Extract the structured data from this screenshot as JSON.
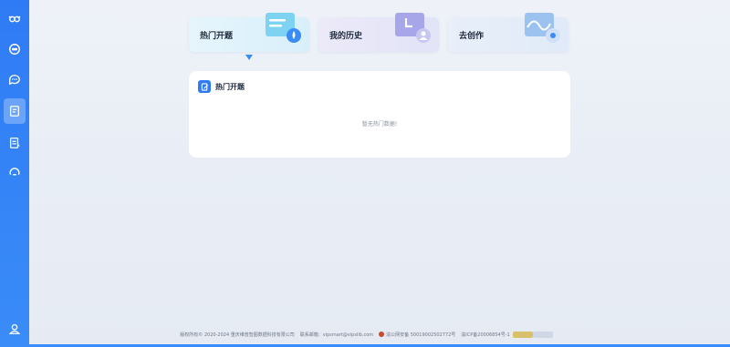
{
  "sidebar": {
    "items": [
      {
        "icon": "owl-logo-icon"
      },
      {
        "icon": "ai-ring-icon"
      },
      {
        "icon": "chat-bubble-icon"
      },
      {
        "icon": "document-icon",
        "active": true
      },
      {
        "icon": "notebook-icon"
      },
      {
        "icon": "cycle-icon"
      }
    ],
    "bottom_icon": "user-icon"
  },
  "tabs": [
    {
      "label": "热门开题",
      "icon": "hot-topic-illustration-icon"
    },
    {
      "label": "我的历史",
      "icon": "history-illustration-icon"
    },
    {
      "label": "去创作",
      "icon": "create-illustration-icon"
    }
  ],
  "panel": {
    "title": "热门开题",
    "empty_text": "暂无热门数据!"
  },
  "footer": {
    "copyright": "版权所有© 2020-2024 重庆维普智图数据科技有限公司",
    "email": "联系邮箱：vipsmart@vipslib.com",
    "police": "渝公网安备 50019002502772号",
    "icp": "渝ICP备20006854号-1"
  },
  "colors": {
    "accent": "#2f7bf5",
    "sidebar": "#3a8cf8"
  }
}
